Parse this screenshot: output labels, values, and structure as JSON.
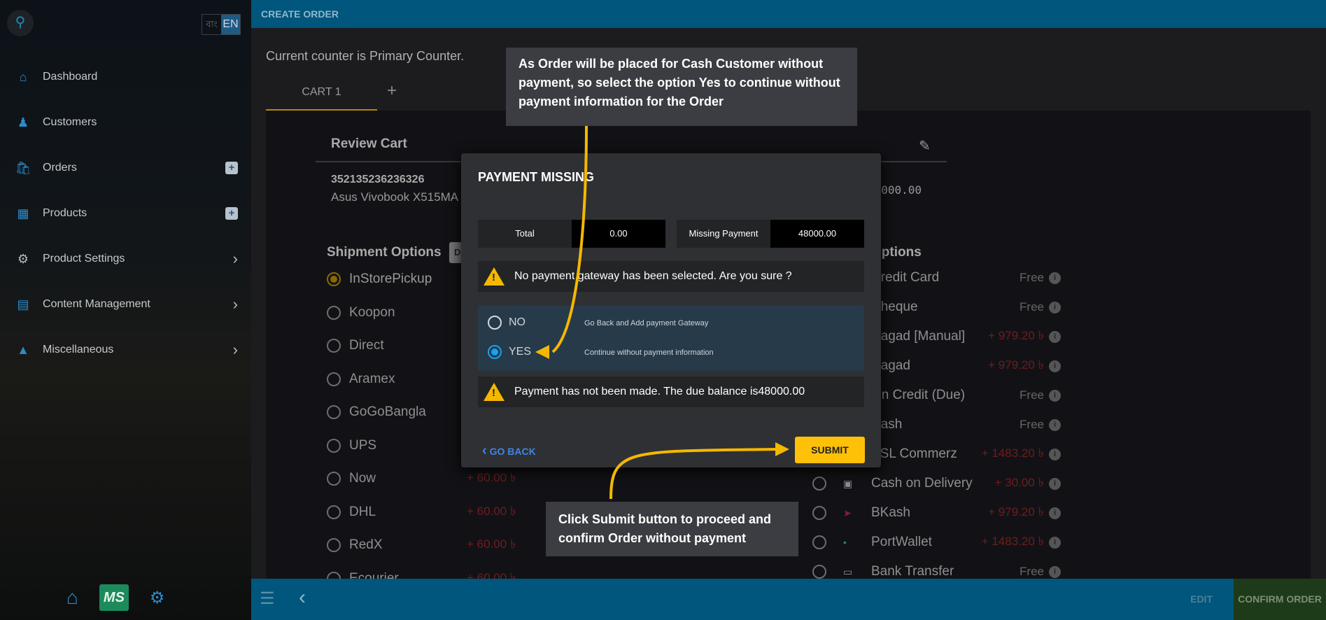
{
  "sidebar": {
    "lang_bn": "বাং",
    "lang_en": "EN",
    "items": [
      {
        "label": "Dashboard",
        "icon": "home-icon"
      },
      {
        "label": "Customers",
        "icon": "users-icon"
      },
      {
        "label": "Orders",
        "icon": "shopping-bag-icon"
      },
      {
        "label": "Products",
        "icon": "boxes-icon"
      },
      {
        "label": "Product Settings",
        "icon": "gear-icon"
      },
      {
        "label": "Content Management",
        "icon": "document-icon"
      },
      {
        "label": "Miscellaneous",
        "icon": "shapes-icon"
      }
    ],
    "ms_logo": "MS"
  },
  "header": {
    "title": "CREATE ORDER"
  },
  "main": {
    "counter": "Current counter is Primary Counter.",
    "tab": "CART 1",
    "tab_add": "+",
    "review_title": "Review Cart",
    "product_code": "352135236236326",
    "product_name": "Asus Vivobook X515MA",
    "product_price": "48000.00",
    "shipment_title": "Shipment Options",
    "shipment_badge": "D",
    "shipments": [
      {
        "label": "InStorePickup",
        "price": "",
        "selected": true
      },
      {
        "label": "Koopon",
        "price": ""
      },
      {
        "label": "Direct",
        "price": ""
      },
      {
        "label": "Aramex",
        "price": ""
      },
      {
        "label": "GoGoBangla",
        "price": ""
      },
      {
        "label": "UPS",
        "price": ""
      },
      {
        "label": "Now",
        "price": "+ 60.00 ৳"
      },
      {
        "label": "DHL",
        "price": "+ 60.00 ৳"
      },
      {
        "label": "RedX",
        "price": "+ 60.00 ৳"
      },
      {
        "label": "Ecourier",
        "price": "+ 60.00 ৳"
      }
    ],
    "payment_title": "Options",
    "payments": [
      {
        "label": "Credit Card",
        "price": "Free"
      },
      {
        "label": "Cheque",
        "price": "Free"
      },
      {
        "label": "Nagad [Manual]",
        "price": "+ 979.20 ৳"
      },
      {
        "label": "Nagad",
        "price": "+ 979.20 ৳"
      },
      {
        "label": "On Credit (Due)",
        "price": "Free"
      },
      {
        "label": "Cash",
        "price": "Free"
      },
      {
        "label": "SSL Commerz",
        "price": "+ 1483.20 ৳"
      },
      {
        "label": "Cash on Delivery",
        "price": "+ 30.00 ৳"
      },
      {
        "label": "BKash",
        "price": "+ 979.20 ৳"
      },
      {
        "label": "PortWallet",
        "price": "+ 1483.20 ৳"
      },
      {
        "label": "Bank Transfer",
        "price": "Free"
      }
    ]
  },
  "modal": {
    "title": "PAYMENT MISSING",
    "total_label": "Total",
    "total_value": "0.00",
    "missing_label": "Missing Payment",
    "missing_value": "48000.00",
    "warning1": "No payment gateway has been selected. Are you sure ?",
    "no_label": "NO",
    "no_desc": "Go Back and Add payment Gateway",
    "yes_label": "YES",
    "yes_desc": "Continue without payment information",
    "selected": "YES",
    "warning2": "Payment has not been made. The due balance is48000.00",
    "go_back": "GO BACK",
    "submit": "SUBMIT"
  },
  "callouts": {
    "top": "As Order will be placed for Cash Customer without payment, so select the option Yes to continue without payment information for the Order",
    "bottom": "Click Submit button to proceed and confirm Order without payment"
  },
  "footer": {
    "edit": "EDIT",
    "confirm": "CONFIRM ORDER"
  },
  "colors": {
    "accent": "#ffc107",
    "topbar": "#00567c",
    "radio_selected": "#17a3ef"
  }
}
